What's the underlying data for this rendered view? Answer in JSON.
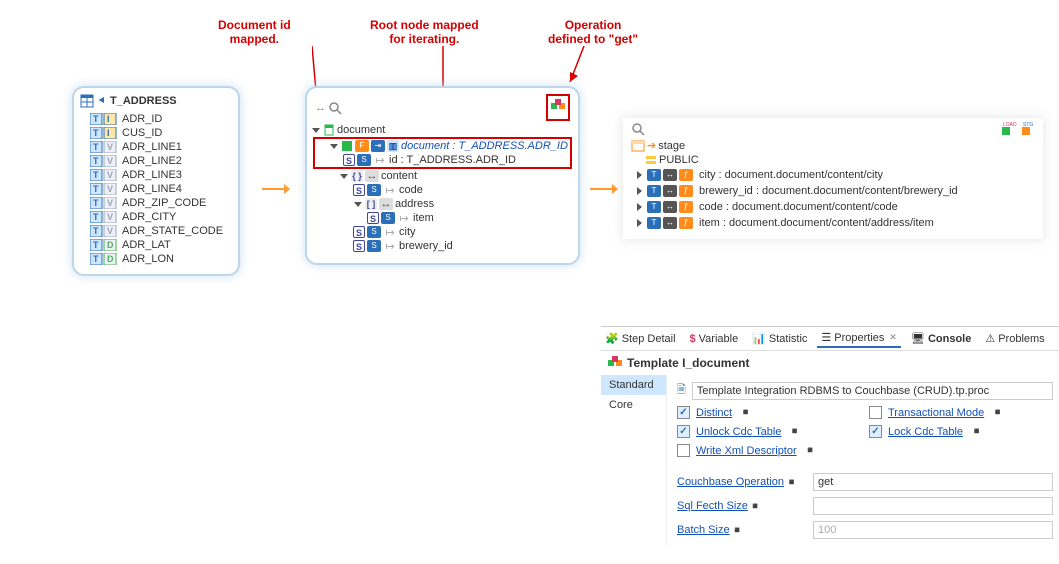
{
  "annotations": {
    "doc_id": "Document id\nmapped.",
    "root_node": "Root node mapped\nfor iterating.",
    "operation": "Operation\ndefined to \"get\""
  },
  "source": {
    "name": "T_ADDRESS",
    "columns": [
      {
        "name": "ADR_ID",
        "pk": true
      },
      {
        "name": "CUS_ID",
        "pk": true
      },
      {
        "name": "ADR_LINE1",
        "type": "V"
      },
      {
        "name": "ADR_LINE2",
        "type": "V"
      },
      {
        "name": "ADR_LINE3",
        "type": "V"
      },
      {
        "name": "ADR_LINE4",
        "type": "V"
      },
      {
        "name": "ADR_ZIP_CODE",
        "type": "V"
      },
      {
        "name": "ADR_CITY",
        "type": "V"
      },
      {
        "name": "ADR_STATE_CODE",
        "type": "V"
      },
      {
        "name": "ADR_LAT",
        "type": "D"
      },
      {
        "name": "ADR_LON",
        "type": "D"
      }
    ]
  },
  "doc": {
    "root": "document",
    "map_doc": "document : T_ADDRESS.ADR_ID",
    "id": "id : T_ADDRESS.ADR_ID",
    "content": "content",
    "code": "code",
    "address": "address",
    "item": "item",
    "city": "city",
    "brewery_id": "brewery_id"
  },
  "stage": {
    "header": "stage",
    "schema": "PUBLIC",
    "rows": [
      "city : document.document/content/city",
      "brewery_id : document.document/content/brewery_id",
      "code : document.document/content/code",
      "item : document.document/content/address/item"
    ]
  },
  "tabs": {
    "step": "Step Detail",
    "variable": "Variable",
    "statistic": "Statistic",
    "properties": "Properties",
    "console": "Console",
    "problems": "Problems"
  },
  "props": {
    "title": "Template I_document",
    "side_standard": "Standard",
    "side_core": "Core",
    "filename_label": "",
    "filename_value": "Template Integration RDBMS to Couchbase (CRUD).tp.proc",
    "distinct": "Distinct",
    "transactional": "Transactional Mode",
    "unlock": "Unlock Cdc Table",
    "lock": "Lock Cdc Table",
    "writexml": "Write Xml Descriptor",
    "cb_op_label": "Couchbase Operation",
    "cb_op_value": "get",
    "sql_fetch": "Sql Fecth Size",
    "sql_fetch_value": "",
    "batch": "Batch Size",
    "batch_value": "100"
  }
}
